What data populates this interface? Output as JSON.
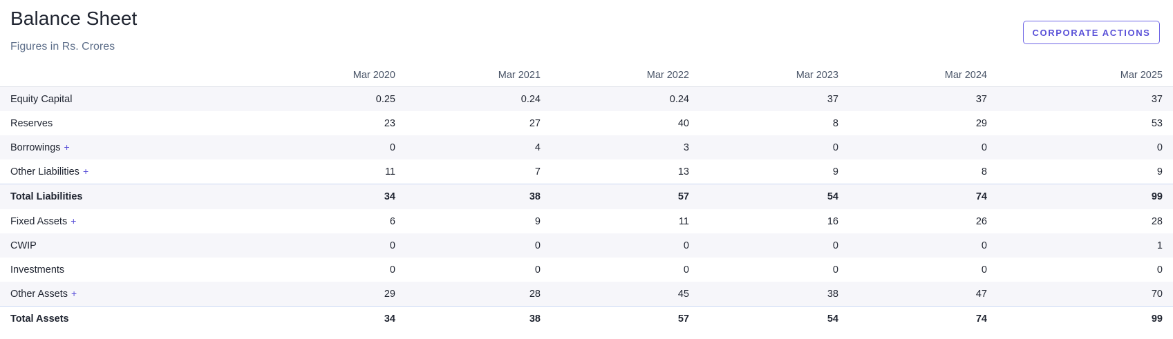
{
  "header": {
    "title": "Balance Sheet",
    "subtitle": "Figures in Rs. Crores",
    "corporate_actions_label": "CORPORATE ACTIONS"
  },
  "table": {
    "columns": [
      "Mar 2020",
      "Mar 2021",
      "Mar 2022",
      "Mar 2023",
      "Mar 2024",
      "Mar 2025"
    ],
    "rows": [
      {
        "label": "Equity Capital",
        "expandable": false,
        "total": false,
        "values": [
          "0.25",
          "0.24",
          "0.24",
          "37",
          "37",
          "37"
        ]
      },
      {
        "label": "Reserves",
        "expandable": false,
        "total": false,
        "values": [
          "23",
          "27",
          "40",
          "8",
          "29",
          "53"
        ]
      },
      {
        "label": "Borrowings",
        "expandable": true,
        "total": false,
        "values": [
          "0",
          "4",
          "3",
          "0",
          "0",
          "0"
        ]
      },
      {
        "label": "Other Liabilities",
        "expandable": true,
        "total": false,
        "values": [
          "11",
          "7",
          "13",
          "9",
          "8",
          "9"
        ]
      },
      {
        "label": "Total Liabilities",
        "expandable": false,
        "total": true,
        "values": [
          "34",
          "38",
          "57",
          "54",
          "74",
          "99"
        ]
      },
      {
        "label": "Fixed Assets",
        "expandable": true,
        "total": false,
        "values": [
          "6",
          "9",
          "11",
          "16",
          "26",
          "28"
        ]
      },
      {
        "label": "CWIP",
        "expandable": false,
        "total": false,
        "values": [
          "0",
          "0",
          "0",
          "0",
          "0",
          "1"
        ]
      },
      {
        "label": "Investments",
        "expandable": false,
        "total": false,
        "values": [
          "0",
          "0",
          "0",
          "0",
          "0",
          "0"
        ]
      },
      {
        "label": "Other Assets",
        "expandable": true,
        "total": false,
        "values": [
          "29",
          "28",
          "45",
          "38",
          "47",
          "70"
        ]
      },
      {
        "label": "Total Assets",
        "expandable": false,
        "total": true,
        "values": [
          "34",
          "38",
          "57",
          "54",
          "74",
          "99"
        ]
      }
    ],
    "expand_symbol": "+"
  },
  "colors": {
    "accent": "#5a51d8",
    "stripe": "#f6f6fa",
    "subtitle": "#5e6f8a",
    "total_border": "#c9d6f2"
  }
}
